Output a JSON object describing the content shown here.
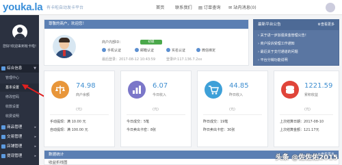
{
  "header": {
    "logo": "youka.la",
    "logo_sub": "有卡啦自动发卡平台",
    "nav": [
      "首页",
      "联系我们",
      "订单查询",
      "站内消息(0)"
    ]
  },
  "sidebar": {
    "user_text": "您好!欢迎来到有卡啦!",
    "groups": [
      {
        "label": "综合信息",
        "caret": "▼"
      },
      {
        "label": "商品管理",
        "caret": "▸"
      },
      {
        "label": "交易管理",
        "caret": "▸"
      },
      {
        "label": "店铺管理",
        "caret": "▸"
      },
      {
        "label": "提现管理",
        "caret": "▸"
      }
    ],
    "items": [
      "管理中心",
      "基本设置",
      "修改密码",
      "收款设置",
      "收费说明"
    ]
  },
  "profile": {
    "header": "尊敬的商户，欢迎您！",
    "fields": {
      "account_label": "商户内部ID：",
      "level": "初级",
      "time_label": "最后登录：2017-08-12 10:43:59",
      "ip_label": "登录IP:117.136.7.2xx"
    },
    "auths": [
      "手机认证",
      "邮箱认证",
      "实名认证",
      "微信绑定"
    ]
  },
  "notice": {
    "title": "最新平台公告",
    "more": "查看更多",
    "items": [
      "关于进一步加强资金管理公告！",
      "商户投诉受理工作通知",
      "最近关于支付通道的问题",
      "平台分销功能说明"
    ]
  },
  "stats": [
    {
      "value": "74.98",
      "label": "商户余额",
      "unit": "(元)",
      "color": "#e8963a",
      "icon": "scale-icon",
      "lines": [
        "手动提现：满 10.00 元",
        "自动提现：满 100.00 元"
      ]
    },
    {
      "value": "6.07",
      "label": "今日收入",
      "unit": "(元)",
      "color": "#7b77c9",
      "icon": "bar-chart-icon",
      "lines": [
        "今日成交：5笔",
        "今日卖出卡密：8张"
      ]
    },
    {
      "value": "44.85",
      "label": "昨日收入",
      "unit": "(元)",
      "color": "#3ea0d8",
      "icon": "cart-icon",
      "lines": [
        "昨日成交：19笔",
        "昨日卖出卡密：30张"
      ]
    },
    {
      "value": "1221.59",
      "label": "累积收益",
      "unit": "(元)",
      "color": "#e0453a",
      "icon": "coins-icon",
      "lines": [
        "上次结算日期：2017-08-10",
        "上次结算金额：121.17元"
      ]
    }
  ],
  "bottom": {
    "title": "数据统计",
    "sub": "收益折线图",
    "more": "查看更多"
  },
  "watermark": "头条 @佐佐佑2015"
}
